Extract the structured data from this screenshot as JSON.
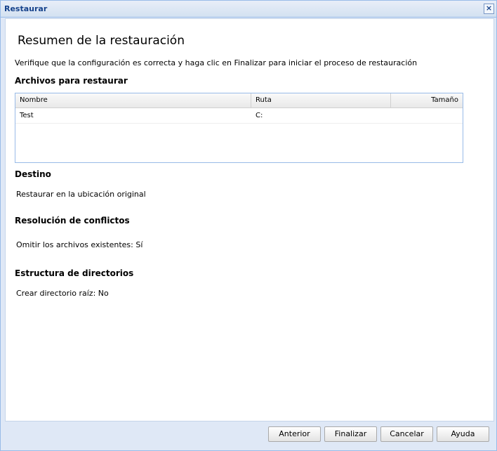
{
  "window": {
    "title": "Restaurar",
    "close_glyph": "×"
  },
  "summary": {
    "heading": "Resumen de la restauración",
    "intro": "Verifique que la configuración es correcta y haga clic en Finalizar para iniciar el proceso de restauración"
  },
  "files": {
    "title": "Archivos para restaurar",
    "columns": [
      "Nombre",
      "Ruta",
      "Tamaño"
    ],
    "rows": [
      {
        "name": "Test",
        "path": "C:",
        "size": ""
      }
    ]
  },
  "destination": {
    "title": "Destino",
    "value": "Restaurar en la ubicación original"
  },
  "conflicts": {
    "title": "Resolución de conflictos",
    "value": "Omitir los archivos existentes: Sí"
  },
  "directory": {
    "title": "Estructura de directorios",
    "value": "Crear directorio raíz: No"
  },
  "buttons": {
    "back": "Anterior",
    "finish": "Finalizar",
    "cancel": "Cancelar",
    "help": "Ayuda"
  }
}
